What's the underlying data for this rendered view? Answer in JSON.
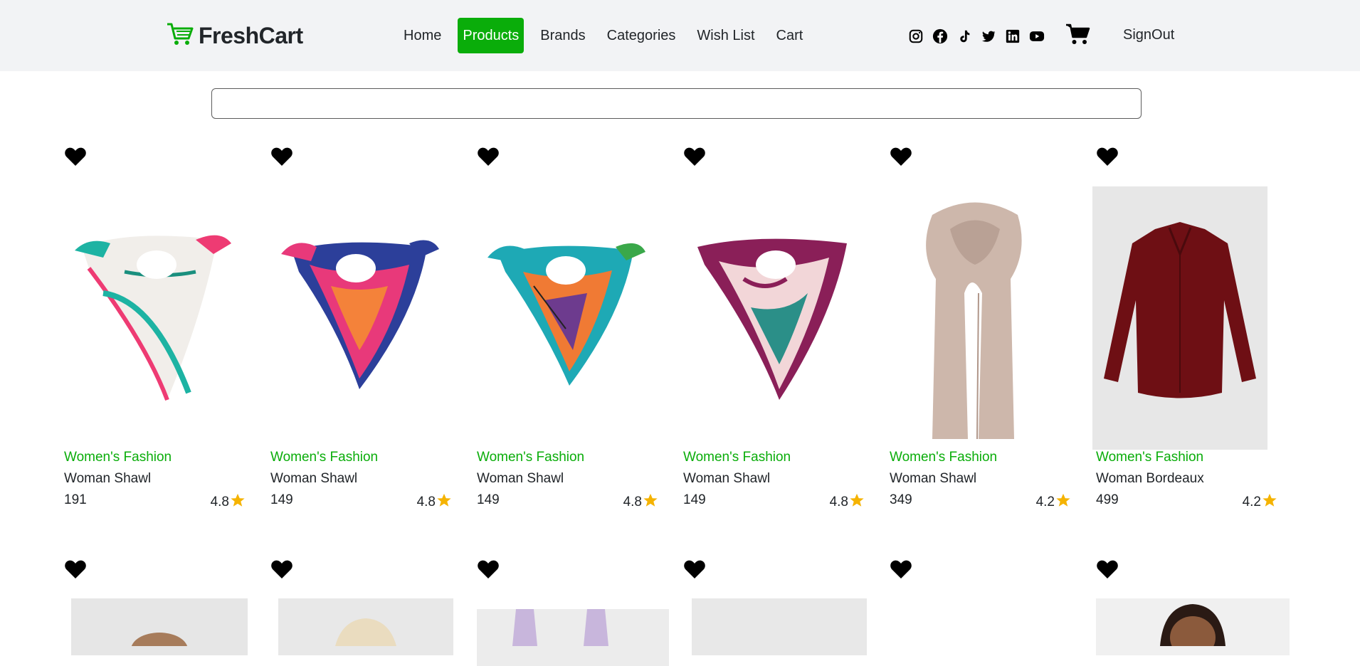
{
  "brand": {
    "name": "FreshCart",
    "icon": "cart-icon",
    "accent": "#0aad0a"
  },
  "nav": {
    "links": [
      {
        "label": "Home",
        "active": false
      },
      {
        "label": "Products",
        "active": true
      },
      {
        "label": "Brands",
        "active": false
      },
      {
        "label": "Categories",
        "active": false
      },
      {
        "label": "Wish List",
        "active": false
      },
      {
        "label": "Cart",
        "active": false
      }
    ],
    "socials": [
      "instagram-icon",
      "facebook-icon",
      "tiktok-icon",
      "twitter-icon",
      "linkedin-icon",
      "youtube-icon"
    ],
    "cart_icon": "shopping-cart-icon",
    "signout_label": "SignOut"
  },
  "search": {
    "value": "",
    "placeholder": ""
  },
  "products": [
    {
      "category": "Women's Fashion",
      "name": "Woman Shawl",
      "price": "191",
      "rating": "4.8",
      "image": "white-green-silk-scarf"
    },
    {
      "category": "Women's Fashion",
      "name": "Woman Shawl",
      "price": "149",
      "rating": "4.8",
      "image": "blue-pink-silk-scarf"
    },
    {
      "category": "Women's Fashion",
      "name": "Woman Shawl",
      "price": "149",
      "rating": "4.8",
      "image": "teal-orange-silk-scarf"
    },
    {
      "category": "Women's Fashion",
      "name": "Woman Shawl",
      "price": "149",
      "rating": "4.8",
      "image": "plum-pink-silk-scarf"
    },
    {
      "category": "Women's Fashion",
      "name": "Woman Shawl",
      "price": "349",
      "rating": "4.2",
      "image": "beige-long-shawl"
    },
    {
      "category": "Women's Fashion",
      "name": "Woman Bordeaux",
      "price": "499",
      "rating": "4.2",
      "image": "bordeaux-shirt"
    }
  ],
  "colors": {
    "category": "#0aad0a",
    "star": "#f5b301",
    "active_nav": "#0aad0a"
  }
}
